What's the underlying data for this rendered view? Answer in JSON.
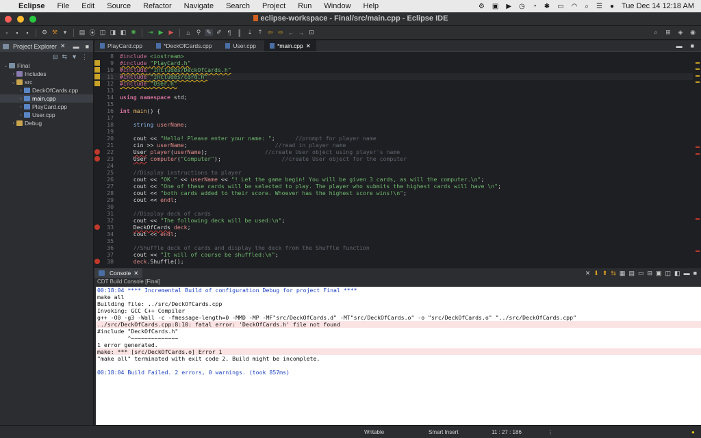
{
  "menubar": {
    "app": "Eclipse",
    "items": [
      "File",
      "Edit",
      "Source",
      "Refactor",
      "Navigate",
      "Search",
      "Project",
      "Run",
      "Window",
      "Help"
    ],
    "clock": "Tue Dec 14  12:18 AM"
  },
  "window": {
    "title": "eclipse-workspace - Final/src/main.cpp - Eclipse IDE"
  },
  "explorer": {
    "tab_label": "Project Explorer",
    "tree": [
      {
        "label": "Final",
        "depth": 0,
        "icon": "project-icon",
        "expanded": true
      },
      {
        "label": "Includes",
        "depth": 1,
        "icon": "includes-icon",
        "expanded": false
      },
      {
        "label": "src",
        "depth": 1,
        "icon": "folder-icon",
        "expanded": true
      },
      {
        "label": "DeckOfCards.cpp",
        "depth": 2,
        "icon": "cpp-file-icon",
        "expanded": false
      },
      {
        "label": "main.cpp",
        "depth": 2,
        "icon": "cpp-file-icon",
        "expanded": false,
        "selected": true
      },
      {
        "label": "PlayCard.cpp",
        "depth": 2,
        "icon": "cpp-file-icon",
        "expanded": false
      },
      {
        "label": "User.cpp",
        "depth": 2,
        "icon": "cpp-file-icon",
        "expanded": false
      },
      {
        "label": "Debug",
        "depth": 1,
        "icon": "folder-icon",
        "expanded": false
      }
    ]
  },
  "editor": {
    "tabs": [
      {
        "label": "PlayCard.cpp",
        "active": false
      },
      {
        "label": "*DeckOfCards.cpp",
        "active": false
      },
      {
        "label": "User.cpp",
        "active": false
      },
      {
        "label": "*main.cpp",
        "active": true
      }
    ],
    "lines": [
      {
        "n": "8",
        "mark": "",
        "html": "<span class=\"pp\">#include</span> <span class=\"st\">&lt;iostream&gt;</span>"
      },
      {
        "n": "9",
        "mark": "warn",
        "html": "<span class=\"sqw\"><span class=\"pp\">#include</span> <span class=\"st\">\"PlayCard.h\"</span></span>"
      },
      {
        "n": "10",
        "mark": "warn",
        "html": "<span class=\"sqw\"><span class=\"pp\">#include</span> <span class=\"st\">\"includes/DeckOfCards.h\"</span></span>"
      },
      {
        "n": "11",
        "mark": "warn",
        "html": "<span class=\"sqw\"><span class=\"pp\">#include</span> <span class=\"st\">\"includes/card.h\"</span></span>",
        "current": true
      },
      {
        "n": "12",
        "mark": "warn",
        "html": "<span class=\"sqw\"><span class=\"pp\">#include</span> <span class=\"st\">\"User.h\"</span></span>"
      },
      {
        "n": "13",
        "mark": "",
        "html": ""
      },
      {
        "n": "14",
        "mark": "",
        "html": "<span class=\"kw\">using namespace</span> <span class=\"id\">std</span>;"
      },
      {
        "n": "15",
        "mark": "",
        "html": ""
      },
      {
        "n": "16",
        "mark": "",
        "html": "<span class=\"kw\">int</span> <span class=\"fn\">main</span>() {"
      },
      {
        "n": "17",
        "mark": "",
        "html": ""
      },
      {
        "n": "18",
        "mark": "",
        "html": "    <span class=\"typ\">string</span> <span class=\"var\">userName</span>;"
      },
      {
        "n": "19",
        "mark": "",
        "html": ""
      },
      {
        "n": "20",
        "mark": "",
        "html": "    cout &lt;&lt; <span class=\"st\">\"Hello! Please enter your name: \"</span>;      <span class=\"cm\">//prompt for player name</span>"
      },
      {
        "n": "21",
        "mark": "",
        "html": "    cin &gt;&gt; <span class=\"var\">userName</span>;                          <span class=\"cm\">//read in player name</span>"
      },
      {
        "n": "22",
        "mark": "err",
        "html": "    <span class=\"sq\">User</span> <span class=\"var\">player</span>(<span class=\"var\">userName</span>);                 <span class=\"cm\">//create User object using player's name</span>"
      },
      {
        "n": "23",
        "mark": "err",
        "html": "    <span class=\"sq\">User</span> <span class=\"var\">computer</span>(<span class=\"st\">\"Computer\"</span>);                  <span class=\"cm\">//create User object for the computer</span>"
      },
      {
        "n": "24",
        "mark": "",
        "html": ""
      },
      {
        "n": "25",
        "mark": "",
        "html": "    <span class=\"cm\">//Display instructions to player</span>"
      },
      {
        "n": "26",
        "mark": "",
        "html": "    cout &lt;&lt; <span class=\"st\">\"OK \"</span> &lt;&lt; <span class=\"var\">userName</span> &lt;&lt; <span class=\"st\">\"! Let the game begin! You will be given 3 cards, as will the computer.\\n\"</span>;"
      },
      {
        "n": "27",
        "mark": "",
        "html": "    cout &lt;&lt; <span class=\"st\">\"One of these cards will be selected to play. The player who submits the highest cards will have \\n\"</span>;"
      },
      {
        "n": "28",
        "mark": "",
        "html": "    cout &lt;&lt; <span class=\"st\">\"both cards added to their score. Whoever has the highest score wins!\\n\"</span>;"
      },
      {
        "n": "29",
        "mark": "",
        "html": "    cout &lt;&lt; <span class=\"var\">endl</span>;"
      },
      {
        "n": "30",
        "mark": "",
        "html": ""
      },
      {
        "n": "31",
        "mark": "",
        "html": "    <span class=\"cm\">//Display deck of cards</span>"
      },
      {
        "n": "32",
        "mark": "",
        "html": "    cout &lt;&lt; <span class=\"st\">\"The following deck will be used:\\n\"</span>;"
      },
      {
        "n": "33",
        "mark": "err",
        "html": "    <span class=\"sq\">DeckOfCards</span> <span class=\"var\">deck</span>;"
      },
      {
        "n": "34",
        "mark": "",
        "html": "    cout &lt;&lt; <span class=\"var\">endl</span>;"
      },
      {
        "n": "35",
        "mark": "",
        "html": ""
      },
      {
        "n": "36",
        "mark": "",
        "html": "    <span class=\"cm\">//Shuffle deck of cards and display the deck from the Shuffle function</span>"
      },
      {
        "n": "37",
        "mark": "",
        "html": "    cout &lt;&lt; <span class=\"st\">\"It will of course be shuffled:\\n\"</span>;"
      },
      {
        "n": "38",
        "mark": "err",
        "html": "    <span class=\"var\">deck</span>.Shuffle();"
      }
    ]
  },
  "console": {
    "tab_label": "Console",
    "subtitle": "CDT Build Console [Final]",
    "lines": [
      {
        "text": "00:18:04 **** Incremental Build of configuration Debug for project Final ****",
        "style": "blue"
      },
      {
        "text": "make all",
        "style": ""
      },
      {
        "text": "Building file: ../src/DeckOfCards.cpp",
        "style": ""
      },
      {
        "text": "Invoking: GCC C++ Compiler",
        "style": ""
      },
      {
        "text": "g++ -O0 -g3 -Wall -c -fmessage-length=0 -MMD -MP -MF\"src/DeckOfCards.d\" -MT\"src/DeckOfCards.o\" -o \"src/DeckOfCards.o\" \"../src/DeckOfCards.cpp\"",
        "style": ""
      },
      {
        "text": "../src/DeckOfCards.cpp:8:10: fatal error: 'DeckOfCards.h' file not found",
        "style": "err"
      },
      {
        "text": "#include \"DeckOfCards.h\"",
        "style": ""
      },
      {
        "text": "         ^~~~~~~~~~~~~~~",
        "style": ""
      },
      {
        "text": "1 error generated.",
        "style": ""
      },
      {
        "text": "make: *** [src/DeckOfCards.o] Error 1",
        "style": "err"
      },
      {
        "text": "\"make all\" terminated with exit code 2. Build might be incomplete.",
        "style": ""
      },
      {
        "text": "",
        "style": ""
      },
      {
        "text": "00:18:04 Build Failed. 2 errors, 0 warnings. (took 857ms)",
        "style": "blue"
      }
    ]
  },
  "status": {
    "writable": "Writable",
    "insert_mode": "Smart Insert",
    "position": "11 : 27 : 186"
  },
  "colors": {
    "accent": "#4a88c7",
    "error": "#c0392b",
    "warning": "#c9a227"
  }
}
